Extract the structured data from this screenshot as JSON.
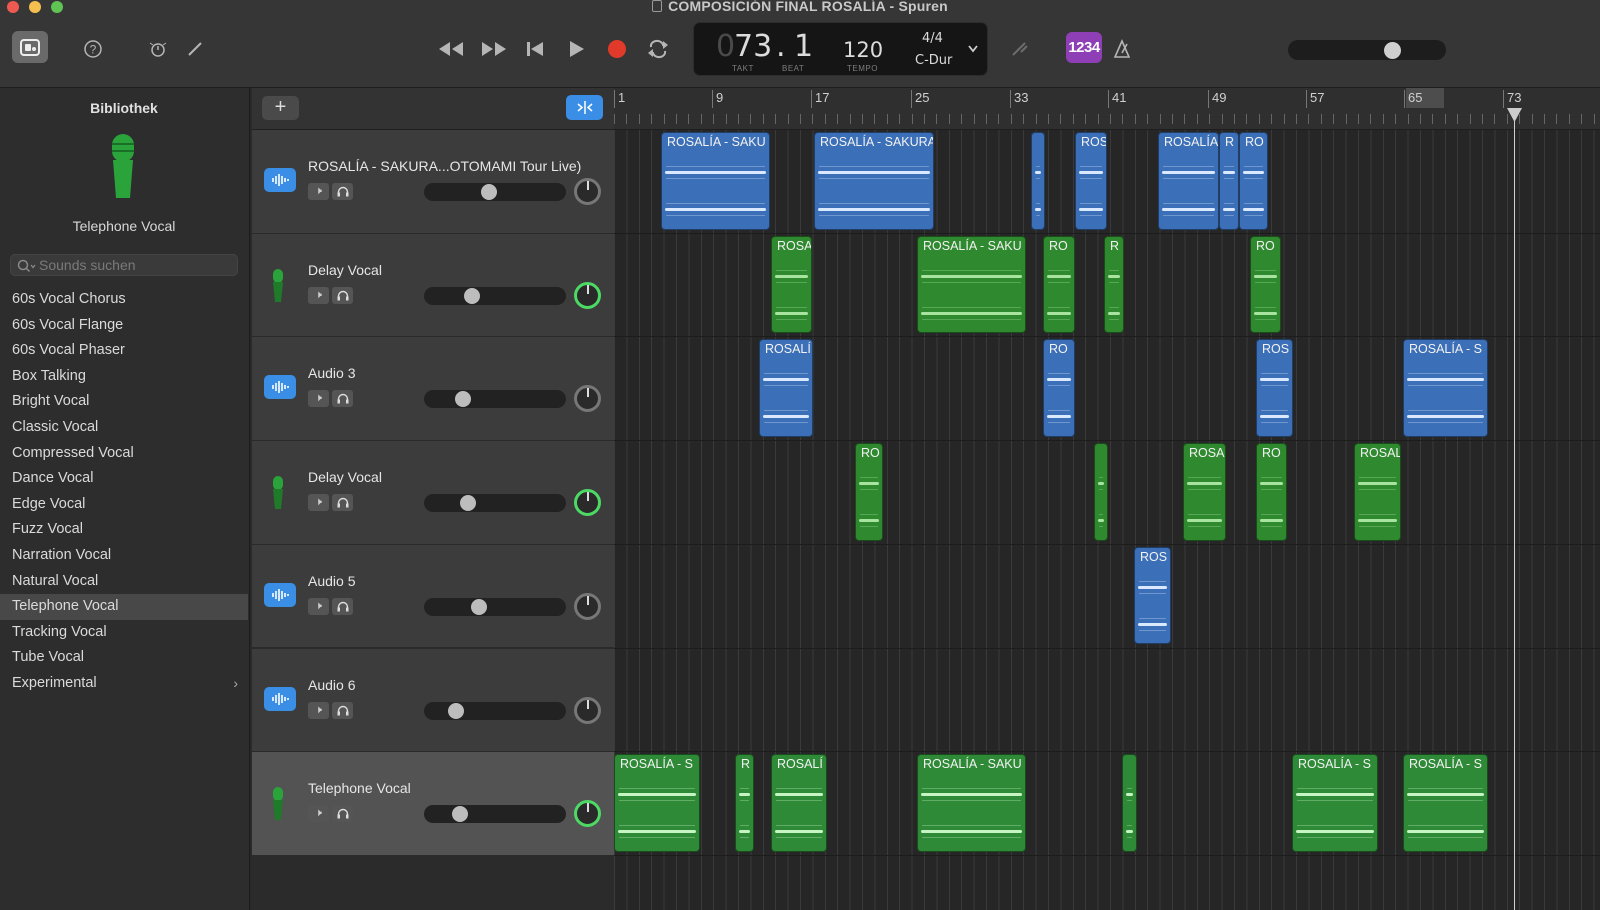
{
  "window": {
    "title": "COMPOSICIÓN FINAL ROSALÍA - Spuren"
  },
  "lcd": {
    "takt": "73",
    "beat": "1",
    "takt_label": "TAKT",
    "beat_label": "BEAT",
    "tempo": "120",
    "tempo_label": "TEMPO",
    "signature": "4/4",
    "key": "C-Dur",
    "count_in": "1234",
    "prefix": "0"
  },
  "library": {
    "title": "Bibliothek",
    "sound": "Telephone Vocal",
    "search_placeholder": "Sounds suchen",
    "items": [
      "60s Vocal Chorus",
      "60s Vocal Flange",
      "60s Vocal Phaser",
      "Box Talking",
      "Bright Vocal",
      "Classic Vocal",
      "Compressed Vocal",
      "Dance Vocal",
      "Edge Vocal",
      "Fuzz Vocal",
      "Narration Vocal",
      "Natural Vocal",
      "Telephone Vocal",
      "Tracking Vocal",
      "Tube Vocal",
      "Experimental"
    ],
    "selected": "Telephone Vocal"
  },
  "tracks": [
    {
      "name": "ROSALÍA - SAKURA...OTOMAMI Tour Live)",
      "type": "audio",
      "volume": 0.4
    },
    {
      "name": "Delay Vocal",
      "type": "vocal",
      "volume": 0.28
    },
    {
      "name": "Audio 3",
      "type": "audio",
      "volume": 0.22
    },
    {
      "name": "Delay Vocal",
      "type": "vocal",
      "volume": 0.25
    },
    {
      "name": "Audio 5",
      "type": "audio",
      "volume": 0.33
    },
    {
      "name": "Audio 6",
      "type": "audio",
      "volume": 0.17
    },
    {
      "name": "Telephone Vocal",
      "type": "vocal",
      "volume": 0.2
    }
  ],
  "ruler": [
    "1",
    "9",
    "17",
    "25",
    "33",
    "41",
    "49",
    "57",
    "65",
    "73"
  ],
  "regions": [
    [
      {
        "label": "ROSALÍA - SAKU",
        "s": 47,
        "e": 156
      },
      {
        "label": "ROSALÍA - SAKURA",
        "s": 200,
        "e": 320
      },
      {
        "label": "",
        "s": 417,
        "e": 431
      },
      {
        "label": "ROS",
        "s": 461,
        "e": 493
      },
      {
        "label": "ROSALÍA",
        "s": 544,
        "e": 605
      },
      {
        "label": "R",
        "s": 605,
        "e": 625
      },
      {
        "label": "RO",
        "s": 625,
        "e": 654
      }
    ],
    [
      {
        "label": "ROSA",
        "s": 157,
        "e": 198
      },
      {
        "label": "ROSALÍA - SAKU",
        "s": 303,
        "e": 412
      },
      {
        "label": "RO",
        "s": 429,
        "e": 461
      },
      {
        "label": "R",
        "s": 490,
        "e": 510
      },
      {
        "label": "RO",
        "s": 636,
        "e": 667
      }
    ],
    [
      {
        "label": "ROSALÍ",
        "s": 145,
        "e": 199
      },
      {
        "label": "RO",
        "s": 429,
        "e": 461
      },
      {
        "label": "ROS",
        "s": 642,
        "e": 679
      },
      {
        "label": "ROSALÍA - S",
        "s": 789,
        "e": 874
      }
    ],
    [
      {
        "label": "RO",
        "s": 241,
        "e": 269
      },
      {
        "label": "",
        "s": 480,
        "e": 494
      },
      {
        "label": "ROSA",
        "s": 569,
        "e": 612
      },
      {
        "label": "RO",
        "s": 642,
        "e": 673
      },
      {
        "label": "ROSAL",
        "s": 740,
        "e": 787
      }
    ],
    [
      {
        "label": "ROS",
        "s": 520,
        "e": 557
      }
    ],
    [],
    [
      {
        "label": "ROSALÍA - S",
        "s": 0,
        "e": 86
      },
      {
        "label": "R",
        "s": 121,
        "e": 140
      },
      {
        "label": "ROSALÍ",
        "s": 157,
        "e": 213
      },
      {
        "label": "ROSALÍA - SAKU",
        "s": 303,
        "e": 412
      },
      {
        "label": "",
        "s": 508,
        "e": 523
      },
      {
        "label": "ROSALÍA - S",
        "s": 678,
        "e": 764
      },
      {
        "label": "ROSALÍA - S",
        "s": 789,
        "e": 874
      }
    ]
  ],
  "colors": {
    "audio": "#3b6fb8",
    "audio_wave": "#dbe9ff",
    "vocal": "#2f8a2f",
    "vocal_wave": "#a9e3a0",
    "tele": "#2e8a36",
    "tele_wave": "#c6f5c3",
    "accent": "#3a8ee6",
    "record": "#e23a2a",
    "count_in": "#8e3fb5"
  }
}
